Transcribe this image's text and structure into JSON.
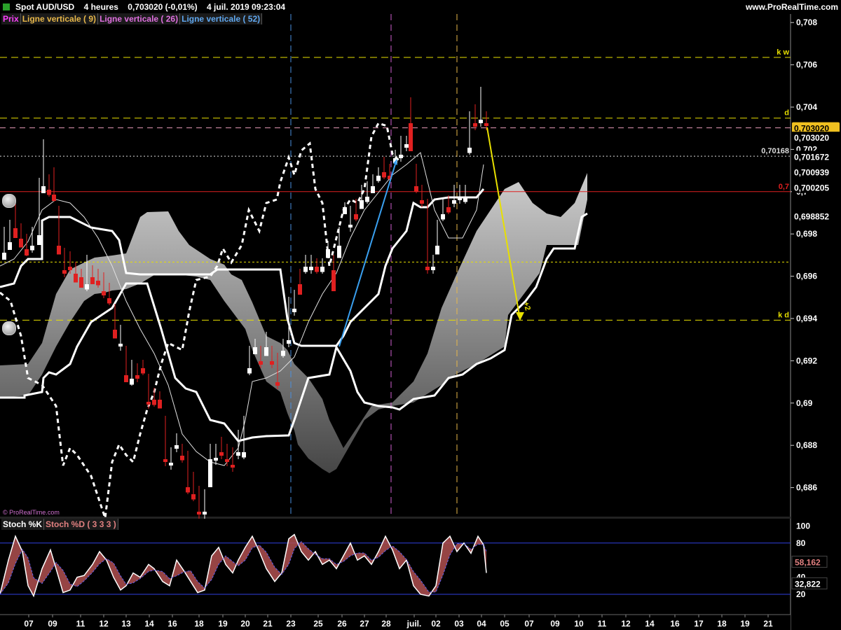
{
  "header": {
    "title": "Spot AUD/USD",
    "timeframe": "4 heures",
    "last_price": "0,703020 (-0,01%)",
    "datetime": "4 juil. 2019 09:23:04",
    "brand": "www.ProRealTime.com",
    "copyright": "© ProRealTime.com"
  },
  "legend": {
    "prix": "Prix",
    "v9": "Ligne verticale ( 9)",
    "v26": "Ligne verticale ( 26)",
    "v52": "Ligne verticale ( 52)"
  },
  "stoch_legend": {
    "k": "Stoch %K",
    "d": "Stoch %D ( 3 3 3 )"
  },
  "colors": {
    "bull": "#ffffff",
    "bear": "#e02020",
    "v9": "#e8b84a",
    "v26": "#d060d0",
    "v52": "#4a90e0",
    "level": "#e8e000",
    "axis": "#ffffff"
  },
  "chart_data": [
    {
      "type": "candlestick",
      "title": "Spot AUD/USD 4 heures",
      "ylim": [
        0.6847,
        0.7087
      ],
      "y_ticks": [
        "0,708",
        "0,706",
        "0,704",
        "0,702",
        "0,7",
        "0,698",
        "0,696",
        "0,694",
        "0,692",
        "0,69",
        "0,688",
        "0,686"
      ],
      "x_ticks": [
        "07",
        "09",
        "11",
        "12",
        "13",
        "14",
        "16",
        "18",
        "19",
        "20",
        "21",
        "23",
        "25",
        "26",
        "27",
        "28",
        "juil.",
        "02",
        "03",
        "04",
        "05",
        "07",
        "09",
        "10",
        "11",
        "12",
        "14",
        "16",
        "17",
        "18",
        "19",
        "21"
      ],
      "grid": false,
      "price_labels": [
        {
          "text": "0,703020",
          "value": 0.70302,
          "highlight": true
        },
        {
          "text": "0,703020",
          "value": 0.70257
        },
        {
          "text": "0,701672",
          "value": 0.701672
        },
        {
          "text": "0,700939",
          "value": 0.700939
        },
        {
          "text": "0,700205",
          "value": 0.700205
        },
        {
          "text": "0,698852",
          "value": 0.698852
        }
      ],
      "levels": [
        {
          "label": "k w",
          "value": 0.70635,
          "style": "dashed-yellow"
        },
        {
          "label": "d",
          "value": 0.70348,
          "style": "dashed-yellow"
        },
        {
          "label": "",
          "value": 0.70302,
          "style": "dashed-pink"
        },
        {
          "label": "0,70168",
          "value": 0.70168,
          "style": "dotted-white"
        },
        {
          "label": "0,7",
          "value": 0.7,
          "style": "solid-red"
        },
        {
          "label": "",
          "value": 0.69667,
          "style": "dotted-yellow"
        },
        {
          "label": "k d",
          "value": 0.69392,
          "style": "dashed-yellow"
        }
      ],
      "vertical_lines": [
        {
          "name": "Ligne verticale ( 52)",
          "x_label": "23"
        },
        {
          "name": "Ligne verticale ( 26)",
          "x_label": "28"
        },
        {
          "name": "Ligne verticale ( 9)",
          "x_label": "03"
        }
      ],
      "annotations": [
        {
          "text": "+2",
          "from_value": 0.70302,
          "to_value": 0.69392
        }
      ],
      "ichimoku": {
        "tenkan": "thin white line",
        "kijun": "thick white line",
        "chikou": "dashed white line",
        "kumo": "gray gradient cloud"
      }
    },
    {
      "type": "line",
      "title": "Stochastic",
      "series": [
        {
          "name": "Stoch %K"
        },
        {
          "name": "Stoch %D ( 3 3 3 )"
        }
      ],
      "ylim": [
        0,
        100
      ],
      "y_ticks": [
        "100",
        "80",
        "40",
        "20"
      ],
      "levels": [
        80,
        20
      ],
      "last_values": [
        {
          "text": "58,162",
          "value": 58.162
        },
        {
          "text": "32,822",
          "value": 32.822
        }
      ]
    }
  ]
}
